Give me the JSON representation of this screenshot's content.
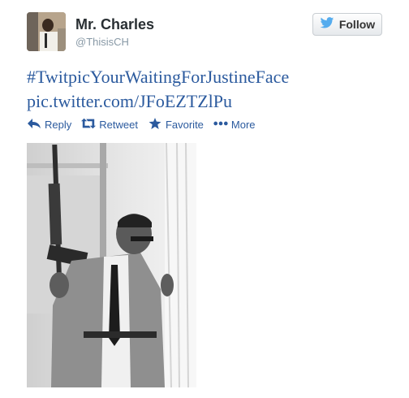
{
  "user": {
    "name": "Mr. Charles",
    "handle": "@ThisisCH"
  },
  "follow_button": {
    "label": "Follow"
  },
  "tweet": {
    "hashtag": "#TwitpicYourWaitingForJustineFace",
    "link": "pic.twitter.com/JFoEZTZlPu"
  },
  "actions": {
    "reply": "Reply",
    "retweet": "Retweet",
    "favorite": "Favorite",
    "more": "More"
  },
  "colors": {
    "link": "#2b5a9e",
    "name": "#292f33",
    "handle": "#8899a6",
    "twitter_blue": "#55acee"
  },
  "icons": [
    "twitter-bird-icon",
    "reply-icon",
    "retweet-icon",
    "star-icon",
    "more-dots-icon"
  ]
}
